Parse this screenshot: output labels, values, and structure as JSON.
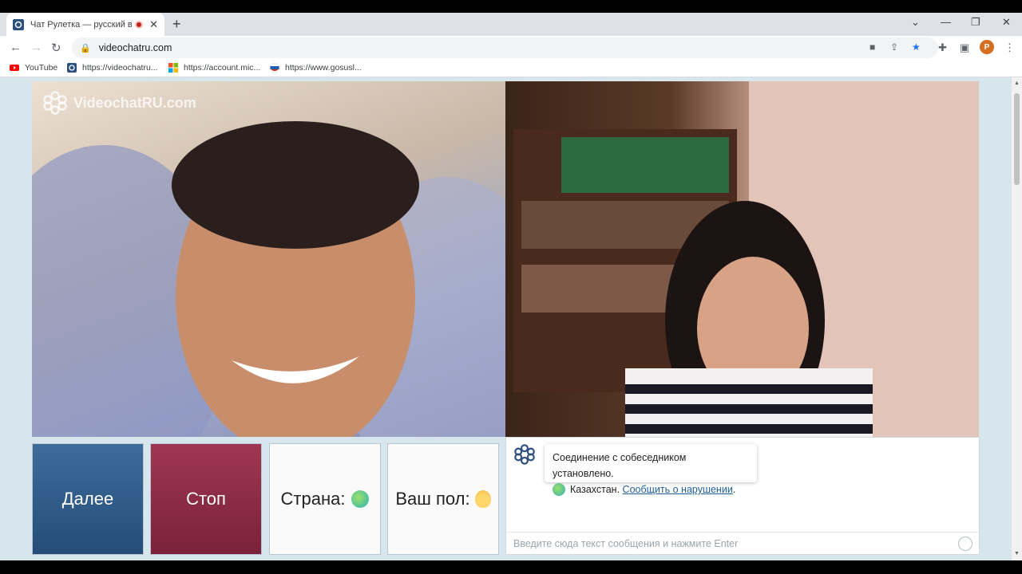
{
  "browser": {
    "tab": {
      "title": "Чат Рулетка — русский вид",
      "close": "✕"
    },
    "new_tab": "+",
    "window_controls": {
      "dropdown": "⌄",
      "minimize": "—",
      "restore": "❐",
      "close": "✕"
    },
    "nav": {
      "back": "←",
      "forward": "→",
      "reload": "↻"
    },
    "url": "videochatru.com",
    "profile_initial": "P",
    "bookmarks": [
      {
        "label": "YouTube",
        "icon": "youtube-icon"
      },
      {
        "label": "https://videochatru...",
        "icon": "videochatru-icon"
      },
      {
        "label": "https://account.mic...",
        "icon": "microsoft-icon"
      },
      {
        "label": "https://www.gosusl...",
        "icon": "gosuslugi-icon"
      }
    ]
  },
  "page": {
    "logo_text": "VideochatRU.com",
    "buttons": {
      "next": "Далее",
      "stop": "Стоп",
      "country": "Страна:",
      "gender": "Ваш пол:"
    },
    "chat": {
      "system_message": "Соединение с собеседником установлено.",
      "country_name": "Казахстан.",
      "report_link": "Сообщить о нарушении",
      "period": ".",
      "input_placeholder": "Введите сюда текст сообщения и нажмите Enter"
    }
  },
  "colors": {
    "next_button": "#2f5a88",
    "stop_button": "#8a2a45",
    "page_bg": "#d7e5ec"
  }
}
